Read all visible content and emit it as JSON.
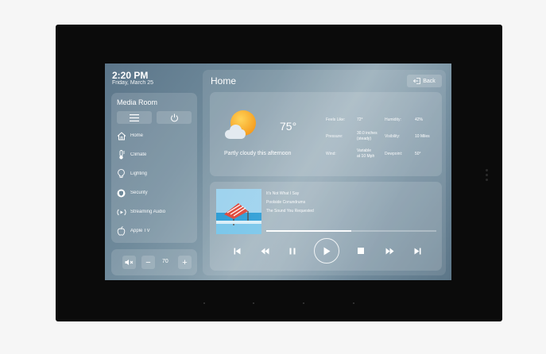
{
  "status": {
    "time": "2:20 PM",
    "date": "Friday, March 25"
  },
  "room": {
    "name": "Media Room",
    "menu_icon": "menu-icon",
    "power_icon": "power-icon",
    "nav": [
      {
        "label": "Home",
        "icon": "home-icon"
      },
      {
        "label": "Climate",
        "icon": "thermometer-icon"
      },
      {
        "label": "Lighting",
        "icon": "lightbulb-icon"
      },
      {
        "label": "Security",
        "icon": "shield-icon"
      },
      {
        "label": "Streaming Audio",
        "icon": "audio-stream-icon"
      },
      {
        "label": "Apple TV",
        "icon": "apple-tv-icon"
      }
    ]
  },
  "volume": {
    "value": "70",
    "mute_icon": "mute-icon",
    "minus": "−",
    "plus": "+"
  },
  "main": {
    "title": "Home",
    "back_label": "Back"
  },
  "weather": {
    "temperature": "75°",
    "forecast": "Partly cloudy this afternoon",
    "icon": "partly-cloudy-icon",
    "feels_like_label": "Feels Like:",
    "feels_like_value": "72°",
    "humidity_label": "Humidity:",
    "humidity_value": "42%",
    "pressure_label": "Pressure:",
    "pressure_value_line1": "30.0 inches",
    "pressure_value_line2": "(steady)",
    "visibility_label": "Visibility:",
    "visibility_value": "10 Miles",
    "wind_label": "Wind:",
    "wind_value_line1": "Variable",
    "wind_value_line2": "at 10 Mph",
    "dewpoint_label": "Dewpoint:",
    "dewpoint_value": "50°"
  },
  "media": {
    "track_title": "It's Not What I Say",
    "album": "Poolside Conundrums",
    "artist": "The Sound You Requested",
    "progress": 0.5,
    "controls": [
      "skip-back-icon",
      "rewind-icon",
      "pause-icon",
      "play-icon",
      "stop-icon",
      "fast-forward-icon",
      "skip-forward-icon"
    ]
  },
  "colors": {
    "frame": "#0b0b0b",
    "screen_tint": "#6f8a9b",
    "accent": "#ffffff"
  }
}
